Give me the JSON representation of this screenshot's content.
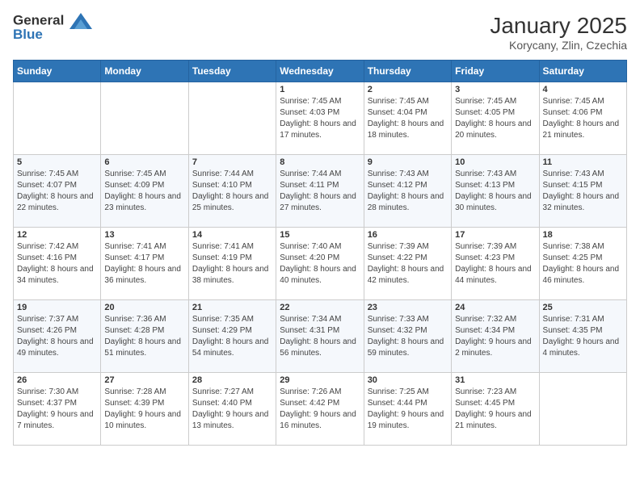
{
  "header": {
    "logo_general": "General",
    "logo_blue": "Blue",
    "title": "January 2025",
    "subtitle": "Korycany, Zlin, Czechia"
  },
  "weekdays": [
    "Sunday",
    "Monday",
    "Tuesday",
    "Wednesday",
    "Thursday",
    "Friday",
    "Saturday"
  ],
  "weeks": [
    [
      {
        "day": null,
        "sunrise": null,
        "sunset": null,
        "daylight": null
      },
      {
        "day": null,
        "sunrise": null,
        "sunset": null,
        "daylight": null
      },
      {
        "day": null,
        "sunrise": null,
        "sunset": null,
        "daylight": null
      },
      {
        "day": "1",
        "sunrise": "Sunrise: 7:45 AM",
        "sunset": "Sunset: 4:03 PM",
        "daylight": "Daylight: 8 hours and 17 minutes."
      },
      {
        "day": "2",
        "sunrise": "Sunrise: 7:45 AM",
        "sunset": "Sunset: 4:04 PM",
        "daylight": "Daylight: 8 hours and 18 minutes."
      },
      {
        "day": "3",
        "sunrise": "Sunrise: 7:45 AM",
        "sunset": "Sunset: 4:05 PM",
        "daylight": "Daylight: 8 hours and 20 minutes."
      },
      {
        "day": "4",
        "sunrise": "Sunrise: 7:45 AM",
        "sunset": "Sunset: 4:06 PM",
        "daylight": "Daylight: 8 hours and 21 minutes."
      }
    ],
    [
      {
        "day": "5",
        "sunrise": "Sunrise: 7:45 AM",
        "sunset": "Sunset: 4:07 PM",
        "daylight": "Daylight: 8 hours and 22 minutes."
      },
      {
        "day": "6",
        "sunrise": "Sunrise: 7:45 AM",
        "sunset": "Sunset: 4:09 PM",
        "daylight": "Daylight: 8 hours and 23 minutes."
      },
      {
        "day": "7",
        "sunrise": "Sunrise: 7:44 AM",
        "sunset": "Sunset: 4:10 PM",
        "daylight": "Daylight: 8 hours and 25 minutes."
      },
      {
        "day": "8",
        "sunrise": "Sunrise: 7:44 AM",
        "sunset": "Sunset: 4:11 PM",
        "daylight": "Daylight: 8 hours and 27 minutes."
      },
      {
        "day": "9",
        "sunrise": "Sunrise: 7:43 AM",
        "sunset": "Sunset: 4:12 PM",
        "daylight": "Daylight: 8 hours and 28 minutes."
      },
      {
        "day": "10",
        "sunrise": "Sunrise: 7:43 AM",
        "sunset": "Sunset: 4:13 PM",
        "daylight": "Daylight: 8 hours and 30 minutes."
      },
      {
        "day": "11",
        "sunrise": "Sunrise: 7:43 AM",
        "sunset": "Sunset: 4:15 PM",
        "daylight": "Daylight: 8 hours and 32 minutes."
      }
    ],
    [
      {
        "day": "12",
        "sunrise": "Sunrise: 7:42 AM",
        "sunset": "Sunset: 4:16 PM",
        "daylight": "Daylight: 8 hours and 34 minutes."
      },
      {
        "day": "13",
        "sunrise": "Sunrise: 7:41 AM",
        "sunset": "Sunset: 4:17 PM",
        "daylight": "Daylight: 8 hours and 36 minutes."
      },
      {
        "day": "14",
        "sunrise": "Sunrise: 7:41 AM",
        "sunset": "Sunset: 4:19 PM",
        "daylight": "Daylight: 8 hours and 38 minutes."
      },
      {
        "day": "15",
        "sunrise": "Sunrise: 7:40 AM",
        "sunset": "Sunset: 4:20 PM",
        "daylight": "Daylight: 8 hours and 40 minutes."
      },
      {
        "day": "16",
        "sunrise": "Sunrise: 7:39 AM",
        "sunset": "Sunset: 4:22 PM",
        "daylight": "Daylight: 8 hours and 42 minutes."
      },
      {
        "day": "17",
        "sunrise": "Sunrise: 7:39 AM",
        "sunset": "Sunset: 4:23 PM",
        "daylight": "Daylight: 8 hours and 44 minutes."
      },
      {
        "day": "18",
        "sunrise": "Sunrise: 7:38 AM",
        "sunset": "Sunset: 4:25 PM",
        "daylight": "Daylight: 8 hours and 46 minutes."
      }
    ],
    [
      {
        "day": "19",
        "sunrise": "Sunrise: 7:37 AM",
        "sunset": "Sunset: 4:26 PM",
        "daylight": "Daylight: 8 hours and 49 minutes."
      },
      {
        "day": "20",
        "sunrise": "Sunrise: 7:36 AM",
        "sunset": "Sunset: 4:28 PM",
        "daylight": "Daylight: 8 hours and 51 minutes."
      },
      {
        "day": "21",
        "sunrise": "Sunrise: 7:35 AM",
        "sunset": "Sunset: 4:29 PM",
        "daylight": "Daylight: 8 hours and 54 minutes."
      },
      {
        "day": "22",
        "sunrise": "Sunrise: 7:34 AM",
        "sunset": "Sunset: 4:31 PM",
        "daylight": "Daylight: 8 hours and 56 minutes."
      },
      {
        "day": "23",
        "sunrise": "Sunrise: 7:33 AM",
        "sunset": "Sunset: 4:32 PM",
        "daylight": "Daylight: 8 hours and 59 minutes."
      },
      {
        "day": "24",
        "sunrise": "Sunrise: 7:32 AM",
        "sunset": "Sunset: 4:34 PM",
        "daylight": "Daylight: 9 hours and 2 minutes."
      },
      {
        "day": "25",
        "sunrise": "Sunrise: 7:31 AM",
        "sunset": "Sunset: 4:35 PM",
        "daylight": "Daylight: 9 hours and 4 minutes."
      }
    ],
    [
      {
        "day": "26",
        "sunrise": "Sunrise: 7:30 AM",
        "sunset": "Sunset: 4:37 PM",
        "daylight": "Daylight: 9 hours and 7 minutes."
      },
      {
        "day": "27",
        "sunrise": "Sunrise: 7:28 AM",
        "sunset": "Sunset: 4:39 PM",
        "daylight": "Daylight: 9 hours and 10 minutes."
      },
      {
        "day": "28",
        "sunrise": "Sunrise: 7:27 AM",
        "sunset": "Sunset: 4:40 PM",
        "daylight": "Daylight: 9 hours and 13 minutes."
      },
      {
        "day": "29",
        "sunrise": "Sunrise: 7:26 AM",
        "sunset": "Sunset: 4:42 PM",
        "daylight": "Daylight: 9 hours and 16 minutes."
      },
      {
        "day": "30",
        "sunrise": "Sunrise: 7:25 AM",
        "sunset": "Sunset: 4:44 PM",
        "daylight": "Daylight: 9 hours and 19 minutes."
      },
      {
        "day": "31",
        "sunrise": "Sunrise: 7:23 AM",
        "sunset": "Sunset: 4:45 PM",
        "daylight": "Daylight: 9 hours and 21 minutes."
      },
      {
        "day": null,
        "sunrise": null,
        "sunset": null,
        "daylight": null
      }
    ]
  ]
}
